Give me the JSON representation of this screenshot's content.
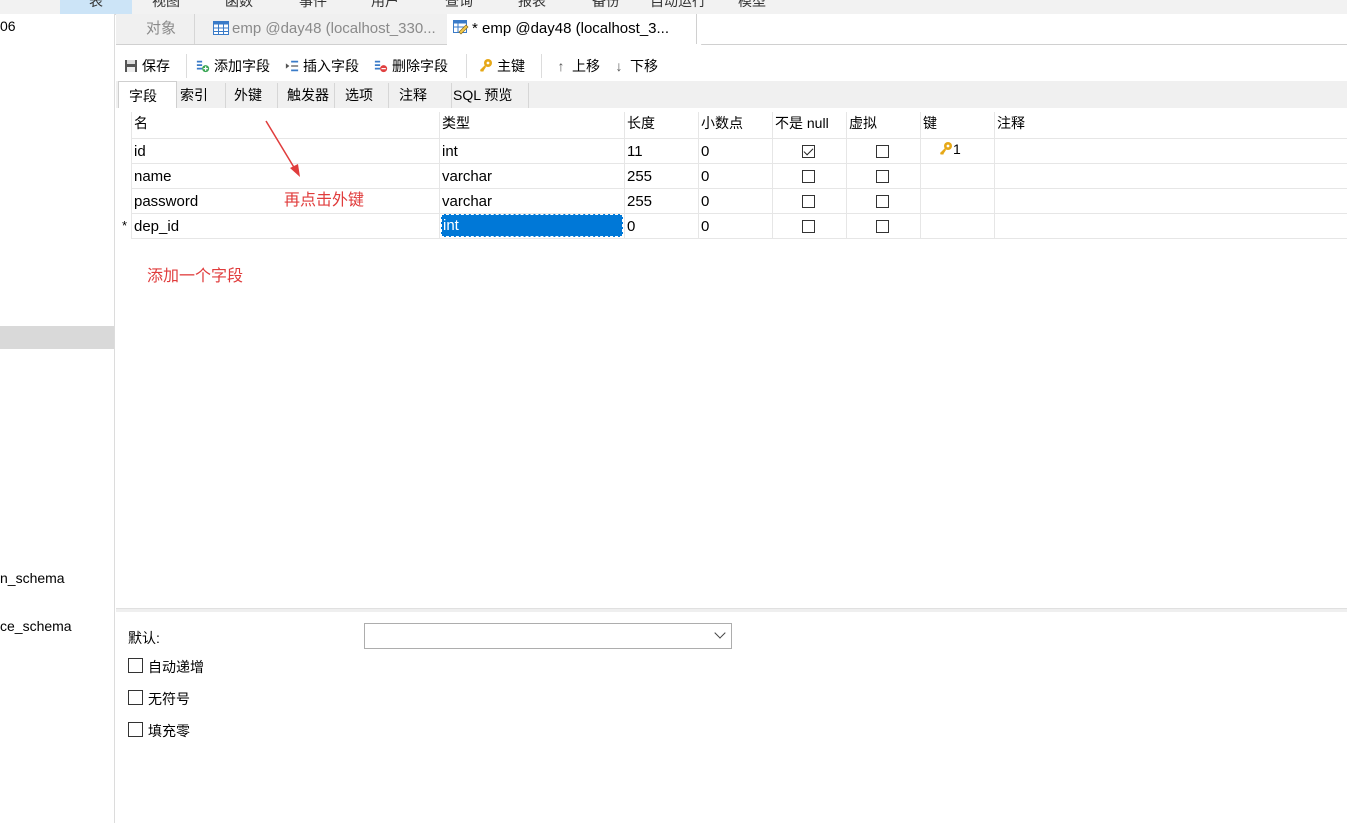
{
  "menu": [
    "视图",
    "函数",
    "事件",
    "用户",
    "查询",
    "报表",
    "备份",
    "自动运行",
    "模型"
  ],
  "menu_active": "表",
  "sidebar": {
    "item_top": "06",
    "item_schema1": "n_schema",
    "item_schema2": "ce_schema"
  },
  "tabs": {
    "objects": "对象",
    "emp_table": "emp @day48 (localhost_330...",
    "emp_design": "* emp @day48 (localhost_3..."
  },
  "toolbar": {
    "save": "保存",
    "add_field": "添加字段",
    "insert_field": "插入字段",
    "delete_field": "删除字段",
    "primary_key": "主键",
    "move_up": "上移",
    "move_down": "下移"
  },
  "subtabs": [
    "字段",
    "索引",
    "外键",
    "触发器",
    "选项",
    "注释",
    "SQL 预览"
  ],
  "columns": [
    "名",
    "类型",
    "长度",
    "小数点",
    "不是 null",
    "虚拟",
    "键",
    "注释"
  ],
  "rows": [
    {
      "name": "id",
      "type": "int",
      "length": "11",
      "decimals": "0",
      "not_null": true,
      "virtual": false,
      "key": "1"
    },
    {
      "name": "name",
      "type": "varchar",
      "length": "255",
      "decimals": "0",
      "not_null": false,
      "virtual": false,
      "key": ""
    },
    {
      "name": "password",
      "type": "varchar",
      "length": "255",
      "decimals": "0",
      "not_null": false,
      "virtual": false,
      "key": ""
    },
    {
      "name": "dep_id",
      "type": "int",
      "length": "0",
      "decimals": "0",
      "not_null": false,
      "virtual": false,
      "key": ""
    }
  ],
  "row_marker": "*",
  "annotations": {
    "click_fk": "再点击外键",
    "add_field": "添加一个字段"
  },
  "props": {
    "default_label": "默认:",
    "default_value": "",
    "auto_increment": "自动递增",
    "unsigned": "无符号",
    "zerofill": "填充零"
  },
  "colors": {
    "selection": "#0078d7",
    "annotation": "#e03c3c"
  }
}
